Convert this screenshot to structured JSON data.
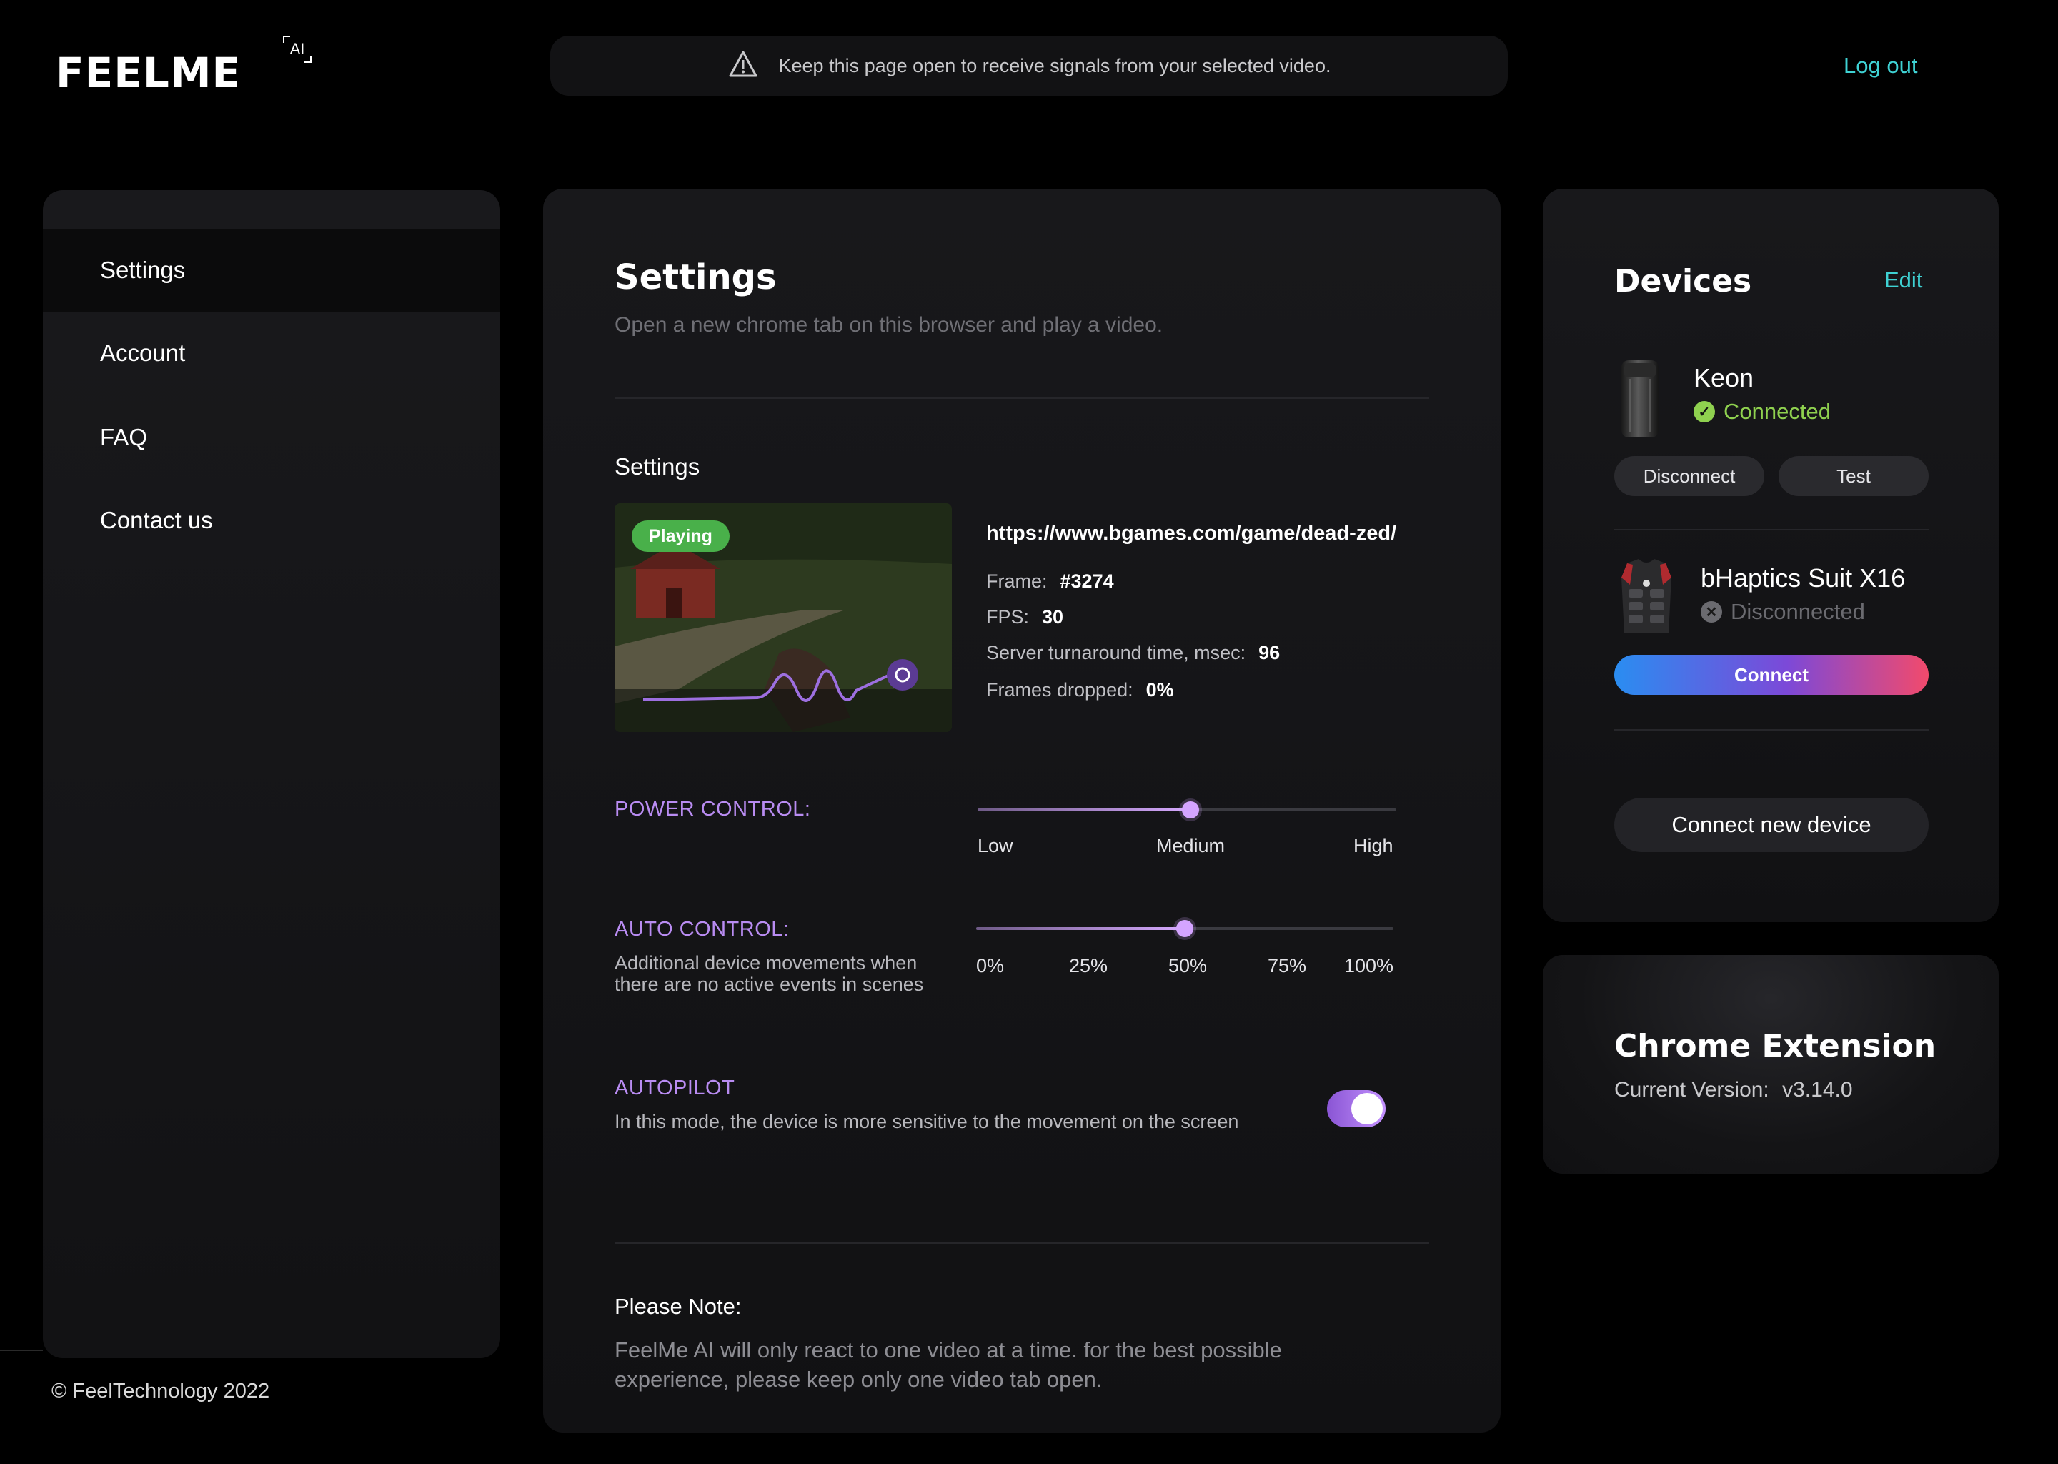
{
  "header": {
    "logo_text": "FEELME",
    "logo_badge": "AI",
    "notice": "Keep this page open to receive signals from your selected video.",
    "logout": "Log out"
  },
  "sidebar": {
    "items": [
      {
        "label": "Settings",
        "active": true
      },
      {
        "label": "Account",
        "active": false
      },
      {
        "label": "FAQ",
        "active": false
      },
      {
        "label": "Contact us",
        "active": false
      }
    ],
    "copyright": "© FeelTechnology 2022"
  },
  "main": {
    "title": "Settings",
    "subtitle": "Open a new chrome tab on this browser and play a video.",
    "section_title": "Settings",
    "video": {
      "status_badge": "Playing",
      "url": "https://www.bgames.com/game/dead-zed/",
      "frame_label": "Frame:",
      "frame_value": "#3274",
      "fps_label": "FPS:",
      "fps_value": "30",
      "turnaround_label": "Server turnaround time, msec:",
      "turnaround_value": "96",
      "dropped_label": "Frames dropped:",
      "dropped_value": "0%"
    },
    "power_control": {
      "label": "POWER CONTROL:",
      "ticks": [
        "Low",
        "Medium",
        "High"
      ],
      "value": 0.5
    },
    "auto_control": {
      "label": "AUTO CONTROL:",
      "description": "Additional device movements when there are no active events in scenes",
      "ticks": [
        "0%",
        "25%",
        "50%",
        "75%",
        "100%"
      ],
      "value": 0.5
    },
    "autopilot": {
      "label": "AUTOPILOT",
      "description": "In this mode, the device is more sensitive to the movement on the screen",
      "enabled": true
    },
    "note": {
      "title": "Please Note:",
      "text": "FeelMe AI will only react to one video at a time. for the best possible experience, please keep only one video tab open."
    }
  },
  "devices": {
    "title": "Devices",
    "edit": "Edit",
    "list": [
      {
        "name": "Keon",
        "status": "Connected",
        "status_color": "#8fd14f",
        "actions": [
          "Disconnect",
          "Test"
        ]
      },
      {
        "name": "bHaptics Suit X16",
        "status": "Disconnected",
        "status_color": "#6b6b70",
        "actions": [
          "Connect"
        ]
      }
    ],
    "connect_new": "Connect new device"
  },
  "chrome_extension": {
    "title": "Chrome Extension",
    "version_label": "Current Version:",
    "version": "v3.14.0"
  },
  "colors": {
    "accent_cyan": "#3fd2d4",
    "accent_purple": "#b98cf2",
    "playing_green": "#49b04a",
    "connected_green": "#8fd14f"
  }
}
